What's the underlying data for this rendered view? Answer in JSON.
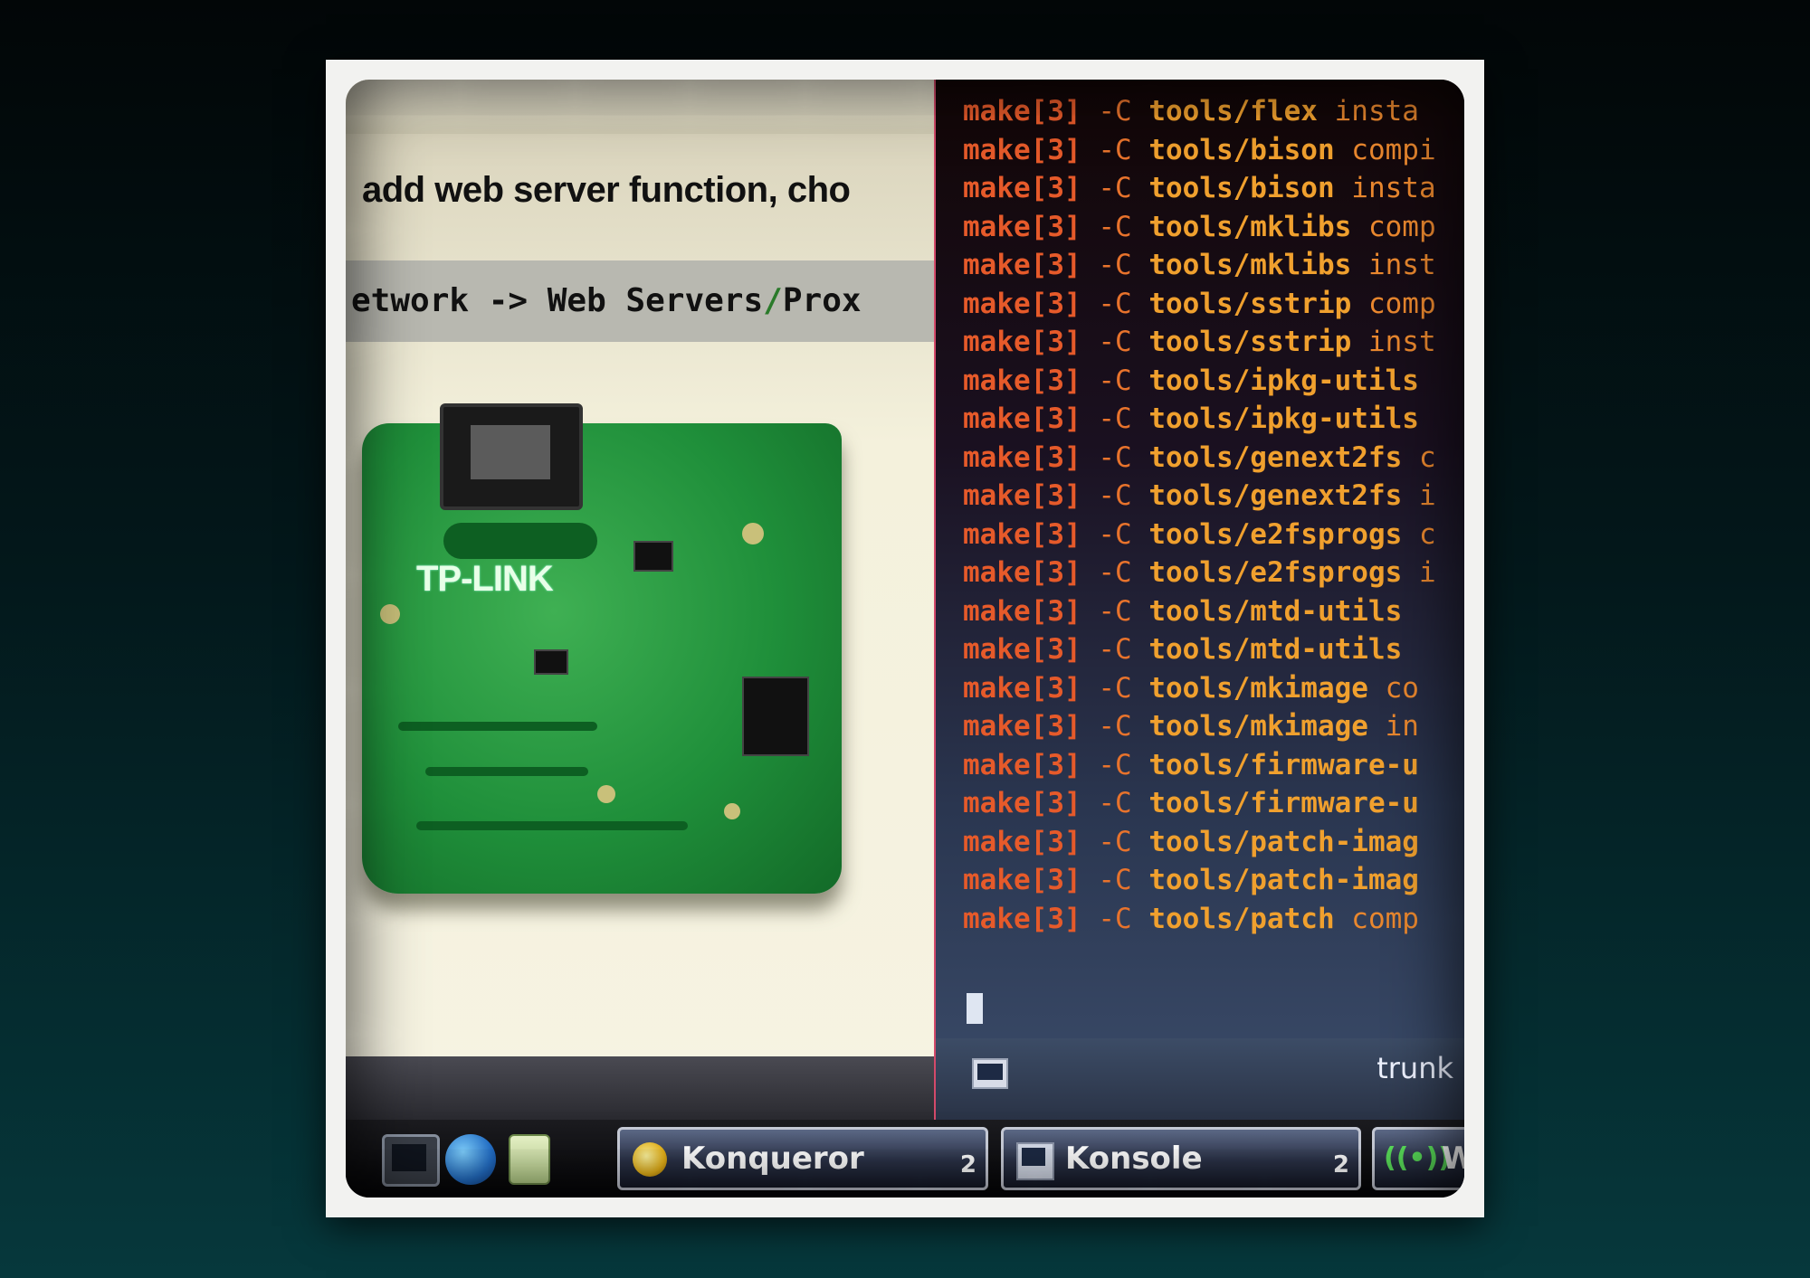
{
  "konqueror": {
    "heading": "add web server function, cho",
    "menu_path": {
      "part1": "etwork -> Web Servers",
      "slash": "/",
      "part2": "Prox"
    },
    "pcb_logo": "TP-LINK"
  },
  "konsole": {
    "lines": [
      {
        "make": "make[3]",
        "flag": "-C",
        "path": "tools/flex",
        "rest": " insta"
      },
      {
        "make": "make[3]",
        "flag": "-C",
        "path": "tools/bison",
        "rest": " compi"
      },
      {
        "make": "make[3]",
        "flag": "-C",
        "path": "tools/bison",
        "rest": " insta"
      },
      {
        "make": "make[3]",
        "flag": "-C",
        "path": "tools/mklibs",
        "rest": " comp"
      },
      {
        "make": "make[3]",
        "flag": "-C",
        "path": "tools/mklibs",
        "rest": " inst"
      },
      {
        "make": "make[3]",
        "flag": "-C",
        "path": "tools/sstrip",
        "rest": " comp"
      },
      {
        "make": "make[3]",
        "flag": "-C",
        "path": "tools/sstrip",
        "rest": " inst"
      },
      {
        "make": "make[3]",
        "flag": "-C",
        "path": "tools/ipkg-utils",
        "rest": ""
      },
      {
        "make": "make[3]",
        "flag": "-C",
        "path": "tools/ipkg-utils",
        "rest": ""
      },
      {
        "make": "make[3]",
        "flag": "-C",
        "path": "tools/genext2fs",
        "rest": " c"
      },
      {
        "make": "make[3]",
        "flag": "-C",
        "path": "tools/genext2fs",
        "rest": " i"
      },
      {
        "make": "make[3]",
        "flag": "-C",
        "path": "tools/e2fsprogs",
        "rest": " c"
      },
      {
        "make": "make[3]",
        "flag": "-C",
        "path": "tools/e2fsprogs",
        "rest": " i"
      },
      {
        "make": "make[3]",
        "flag": "-C",
        "path": "tools/mtd-utils",
        "rest": ""
      },
      {
        "make": "make[3]",
        "flag": "-C",
        "path": "tools/mtd-utils",
        "rest": ""
      },
      {
        "make": "make[3]",
        "flag": "-C",
        "path": "tools/mkimage",
        "rest": " co"
      },
      {
        "make": "make[3]",
        "flag": "-C",
        "path": "tools/mkimage",
        "rest": " in"
      },
      {
        "make": "make[3]",
        "flag": "-C",
        "path": "tools/firmware-u",
        "rest": ""
      },
      {
        "make": "make[3]",
        "flag": "-C",
        "path": "tools/firmware-u",
        "rest": ""
      },
      {
        "make": "make[3]",
        "flag": "-C",
        "path": "tools/patch-imag",
        "rest": ""
      },
      {
        "make": "make[3]",
        "flag": "-C",
        "path": "tools/patch-imag",
        "rest": ""
      },
      {
        "make": "make[3]",
        "flag": "-C",
        "path": "tools/patch",
        "rest": " comp"
      }
    ],
    "status_label": "trunk"
  },
  "taskbar": {
    "tasks": [
      {
        "label": "Konqueror",
        "count": "2",
        "icon": "konqueror-icon"
      },
      {
        "label": "Konsole",
        "count": "2",
        "icon": "konsole-icon"
      },
      {
        "label": "W",
        "count": "",
        "icon": "wifi-icon"
      }
    ],
    "launchers": [
      "konsole-launcher-icon",
      "globe-icon",
      "notes-icon"
    ]
  },
  "colors": {
    "terminal_make": "#e65a2a",
    "terminal_path": "#f0a02e",
    "pcb_green": "#1f8f3a",
    "background": "#06383c"
  }
}
